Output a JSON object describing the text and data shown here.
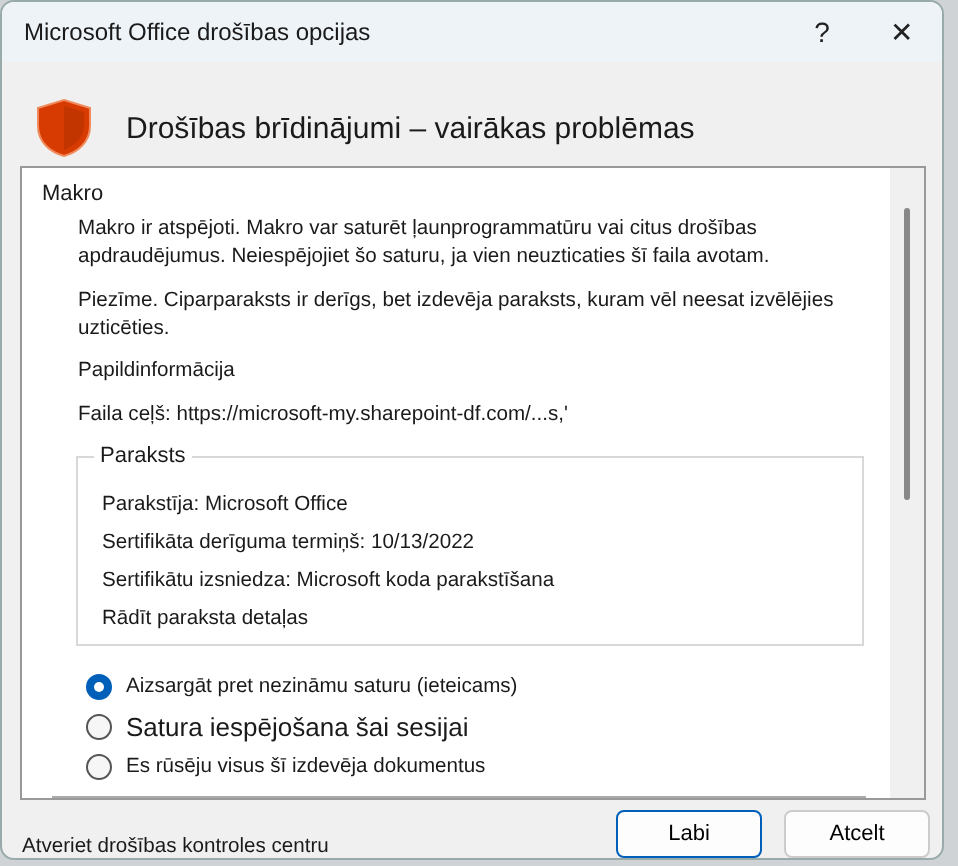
{
  "window": {
    "title": "Microsoft Office drošības opcijas",
    "help": "?",
    "close": "✕"
  },
  "header": {
    "title": "Drošības brīdinājumi – vairākas problēmas"
  },
  "section": {
    "title": "Makro",
    "paragraphs": [
      "Makro ir atspējoti. Makro var saturēt ļaunprogrammatūru vai citus drošības apdraudējumus. Neiespējojiet šo saturu, ja vien neuzticaties šī faila avotam.",
      "Piezīme. Ciparparaksts ir derīgs, bet izdevēja paraksts, kuram vēl neesat izvēlējies uzticēties."
    ],
    "more_info": "Papildinformācija",
    "file_path": "Faila ceļš: https://microsoft-my.sharepoint-df.com/...s,'"
  },
  "signature": {
    "title": "Paraksts",
    "lines": [
      "Parakstīja: Microsoft Office",
      "Sertifikāta derīguma termiņš: 10/13/2022",
      "Sertifikātu izsniedza: Microsoft koda parakstīšana"
    ],
    "details_link": "Rādīt paraksta detaļas"
  },
  "options": [
    {
      "label": "Aizsargāt pret nezināmu saturu (ieteicams)",
      "selected": true
    },
    {
      "label": "Satura iespējošana šai sesijai",
      "selected": false
    },
    {
      "label": "Es rūsēju visus šī izdevēja dokumentus",
      "selected": false
    }
  ],
  "footer": {
    "link": "Atveriet drošības kontroles centru",
    "buttons": [
      {
        "label": "Labi",
        "kind": "primary"
      },
      {
        "label": "Atcelt",
        "kind": "secondary"
      }
    ]
  }
}
